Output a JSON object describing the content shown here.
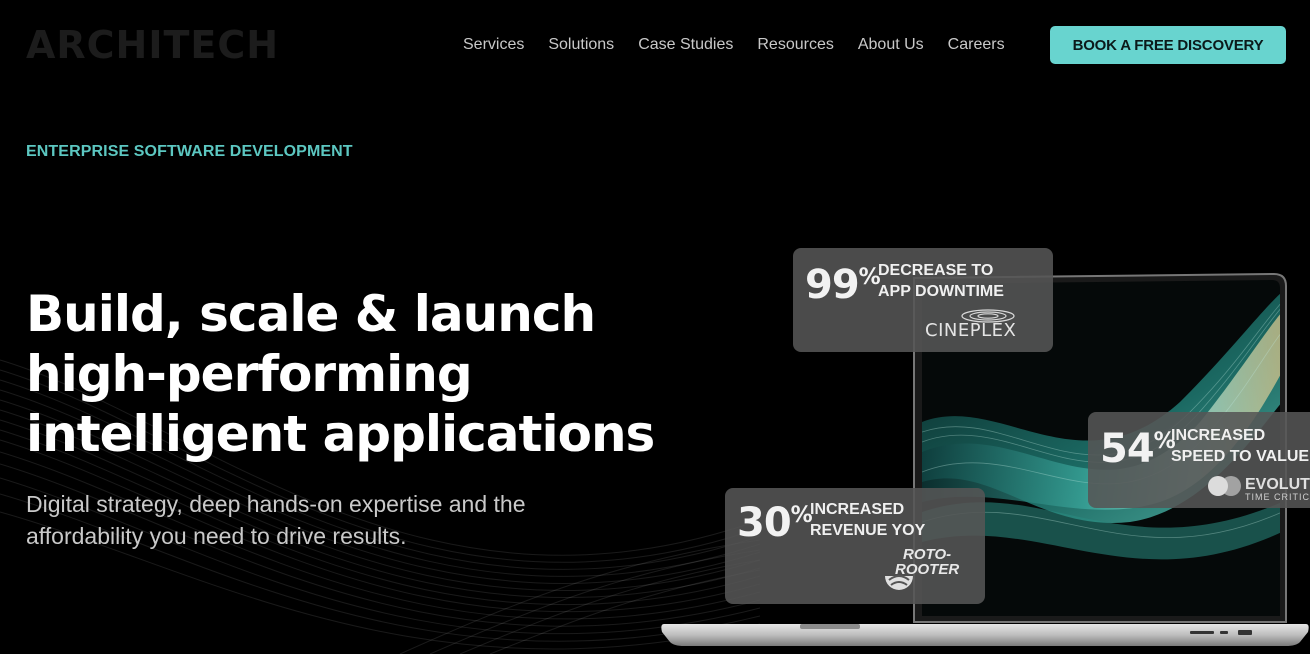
{
  "brand": {
    "logo": "ARCHITECH"
  },
  "nav": {
    "items": [
      "Services",
      "Solutions",
      "Case Studies",
      "Resources",
      "About Us",
      "Careers"
    ],
    "cta": "BOOK A FREE DISCOVERY"
  },
  "hero": {
    "eyebrow": "ENTERPRISE SOFTWARE DEVELOPMENT",
    "headline_lines": [
      "Build, scale & launch",
      "high-performing",
      "intelligent applications"
    ],
    "subtext_lines": [
      "Digital strategy, deep hands-on expertise and the",
      "affordability you need to drive results."
    ]
  },
  "stats": [
    {
      "value": "99",
      "unit": "%",
      "label_lines": [
        "DECREASE TO",
        "APP DOWNTIME"
      ],
      "client": "CINEPLEX"
    },
    {
      "value": "54",
      "unit": "%",
      "label_lines": [
        "INCREASED",
        "SPEED TO VALUE"
      ],
      "client": "EVOLUTION",
      "client_sub": "TIME CRITICAL"
    },
    {
      "value": "30",
      "unit": "%",
      "label_lines": [
        "INCREASED",
        "REVENUE YOY"
      ],
      "client_lines": [
        "ROTO-",
        "ROOTER"
      ]
    }
  ],
  "colors": {
    "accent": "#68d4cf",
    "eyebrow": "#5cc7c1",
    "background": "#000000"
  }
}
